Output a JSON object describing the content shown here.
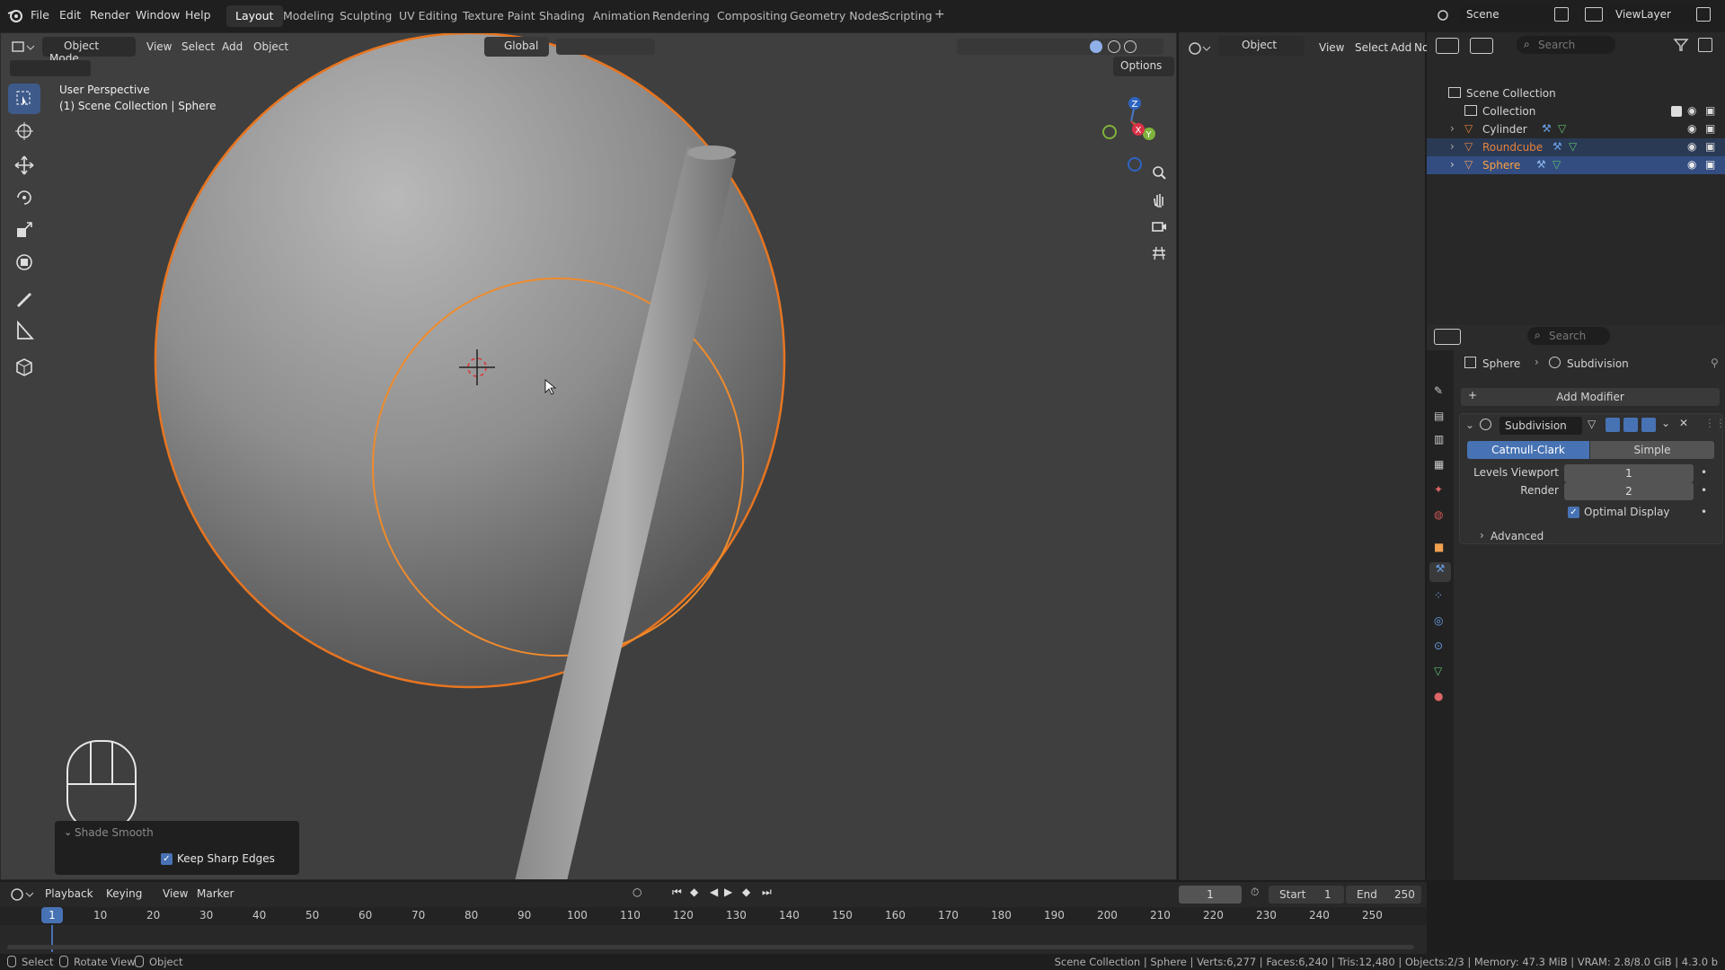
{
  "topbar": {
    "menus": [
      "File",
      "Edit",
      "Render",
      "Window",
      "Help"
    ],
    "workspaces": [
      "Layout",
      "Modeling",
      "Sculpting",
      "UV Editing",
      "Texture Paint",
      "Shading",
      "Animation",
      "Rendering",
      "Compositing",
      "Geometry Nodes",
      "Scripting"
    ],
    "scene": "Scene",
    "view_layer": "ViewLayer"
  },
  "viewport": {
    "mode": "Object Mode",
    "menus": [
      "View",
      "Select",
      "Add",
      "Object"
    ],
    "transform_orientation": "Global",
    "options_label": "Options",
    "info_line1": "User Perspective",
    "info_line2": "(1) Scene Collection | Sphere",
    "gizmo_axes": [
      "Z",
      "X",
      "Y"
    ],
    "last_op_title": "Shade Smooth",
    "last_op_option": "Keep Sharp Edges"
  },
  "editor2": {
    "mode": "Object",
    "menus": [
      "View",
      "Select",
      "Add",
      "No"
    ]
  },
  "outliner": {
    "search_placeholder": "Search",
    "root": "Scene Collection",
    "collection": "Collection",
    "objects": [
      {
        "name": "Cylinder",
        "color": "#d8d8d8"
      },
      {
        "name": "Roundcube",
        "color": "#e8823a"
      },
      {
        "name": "Sphere",
        "color": "#ffffff"
      }
    ]
  },
  "properties": {
    "search_placeholder": "Search",
    "breadcrumb_object": "Sphere",
    "breadcrumb_modifier": "Subdivision",
    "add_modifier": "Add Modifier",
    "modifier_name": "Subdivision",
    "mode_catmull": "Catmull-Clark",
    "mode_simple": "Simple",
    "levels_viewport_label": "Levels Viewport",
    "levels_viewport_value": "1",
    "render_label": "Render",
    "render_value": "2",
    "optimal_display": "Optimal Display",
    "advanced": "Advanced"
  },
  "timeline": {
    "menus": [
      "Playback",
      "Keying",
      "View",
      "Marker"
    ],
    "current_frame": "1",
    "start_label": "Start",
    "start_value": "1",
    "end_label": "End",
    "end_value": "250",
    "ticks": [
      "1",
      "10",
      "20",
      "30",
      "40",
      "50",
      "60",
      "70",
      "80",
      "90",
      "100",
      "110",
      "120",
      "130",
      "140",
      "150",
      "160",
      "170",
      "180",
      "190",
      "200",
      "210",
      "220",
      "230",
      "240",
      "250"
    ]
  },
  "statusbar": {
    "select": "Select",
    "rotate": "Rotate View",
    "object": "Object",
    "stats": "Scene Collection | Sphere | Verts:6,277 | Faces:6,240 | Tris:12,480 | Objects:2/3 | Memory: 47.3 MiB | VRAM: 2.8/8.0 GiB | 4.3.0 b"
  },
  "colors": {
    "accent": "#4772b3",
    "selection_orange": "#f08020",
    "active_orange": "#ffa040"
  }
}
